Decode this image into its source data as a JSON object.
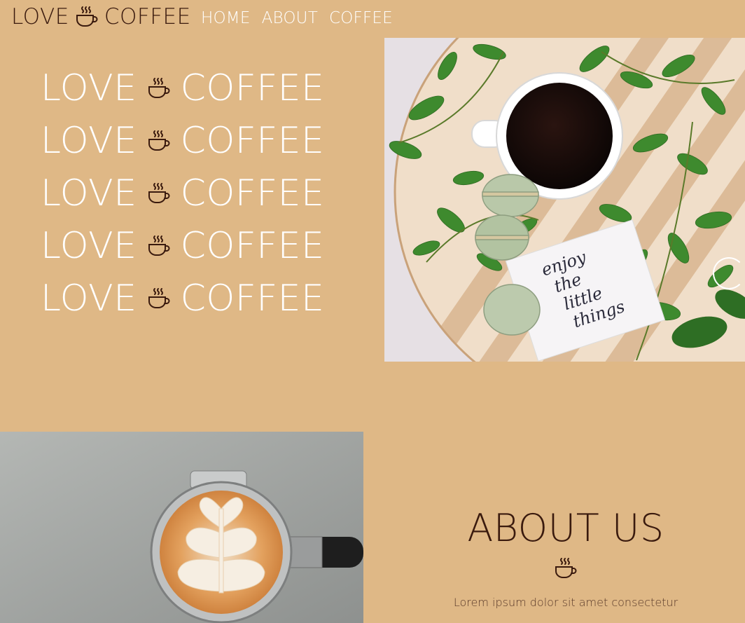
{
  "nav": {
    "brand_left": "LOVE",
    "brand_right": "COFFEE",
    "brand_icon": "coffee-cup-icon",
    "links": [
      {
        "label": "HOME"
      },
      {
        "label": "ABOUT"
      },
      {
        "label": "COFFEE"
      }
    ]
  },
  "hero": {
    "lines": [
      {
        "left": "LOVE",
        "right": "COFFEE"
      },
      {
        "left": "LOVE",
        "right": "COFFEE"
      },
      {
        "left": "LOVE",
        "right": "COFFEE"
      },
      {
        "left": "LOVE",
        "right": "COFFEE"
      },
      {
        "left": "LOVE",
        "right": "COFFEE"
      }
    ],
    "line_icon": "coffee-cup-icon",
    "photo_note": [
      "enjoy",
      "the",
      "little",
      "things"
    ]
  },
  "about": {
    "title": "ABOUT US",
    "icon": "coffee-cup-icon",
    "text": "Lorem ipsum dolor sit amet consectetur"
  },
  "colors": {
    "background": "#DFB886",
    "brand_text": "#3A1A0E",
    "light_text": "#FFFFFF"
  }
}
